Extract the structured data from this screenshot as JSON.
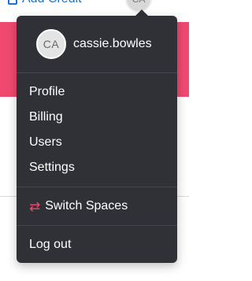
{
  "background": {
    "top_link_label": "Add Credit",
    "top_avatar_initials": "CA",
    "accent_color": "#f0496f",
    "link_color": "#1a73c8"
  },
  "menu": {
    "avatar_initials": "CA",
    "username": "cassie.bowles",
    "items": [
      {
        "label": "Profile"
      },
      {
        "label": "Billing"
      },
      {
        "label": "Users"
      },
      {
        "label": "Settings"
      }
    ],
    "switch_spaces": {
      "label": "Switch Spaces",
      "icon": "switch-arrows-icon"
    },
    "logout": {
      "label": "Log out"
    },
    "background_color": "#2f3136"
  }
}
